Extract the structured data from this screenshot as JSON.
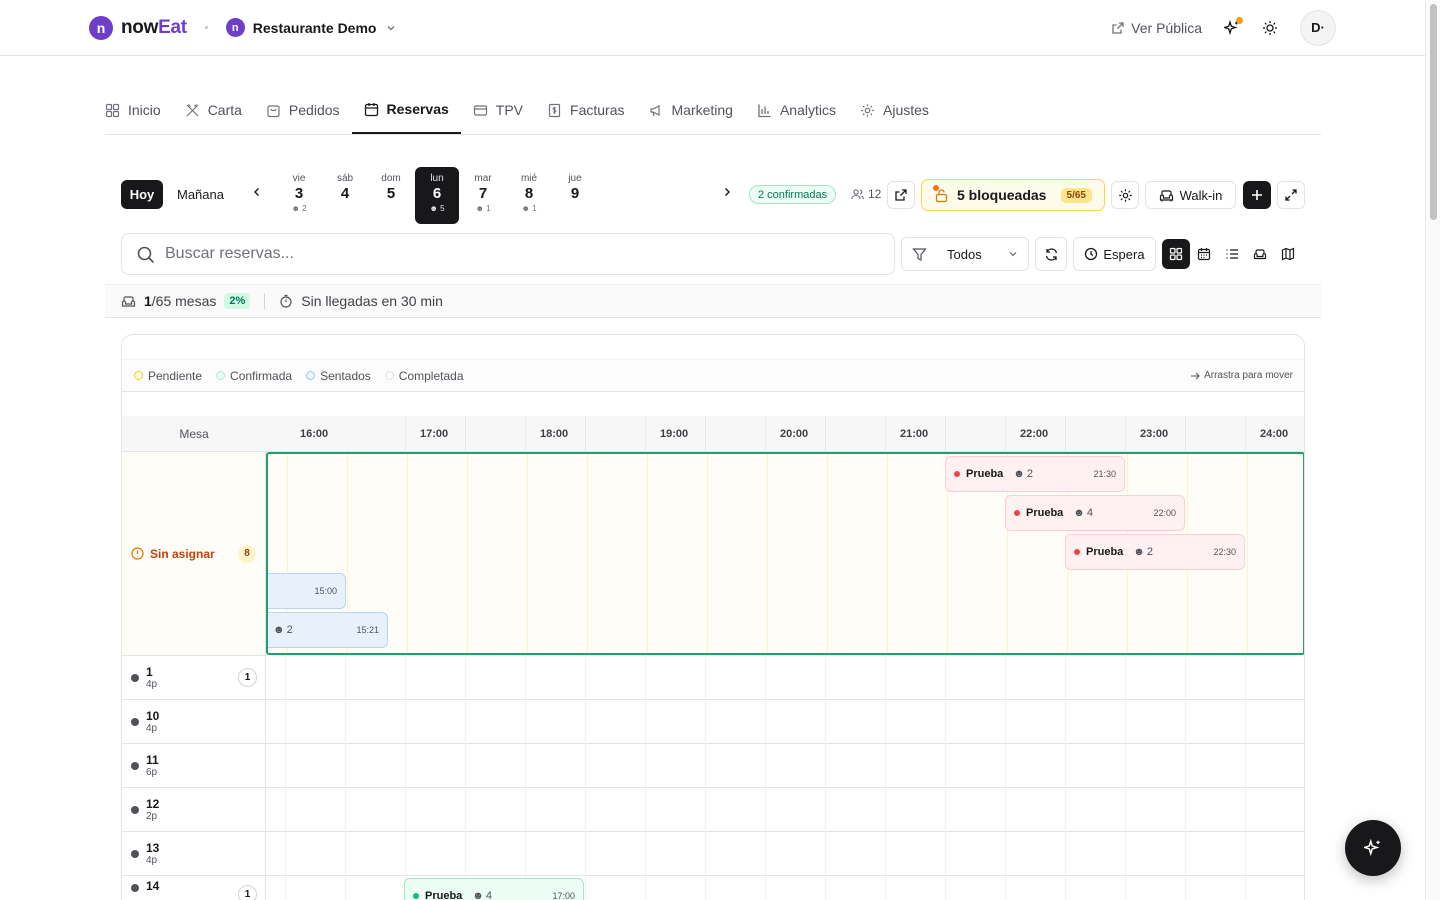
{
  "header": {
    "brand_a": "now",
    "brand_b": "Eat",
    "brand_mark": "n",
    "restaurant_mark": "n",
    "restaurant": "Restaurante Demo",
    "ver_publica": "Ver Pública",
    "avatar": "D·"
  },
  "nav": [
    {
      "label": "Inicio",
      "icon": "grid-icon"
    },
    {
      "label": "Carta",
      "icon": "utensils-icon"
    },
    {
      "label": "Pedidos",
      "icon": "bag-icon"
    },
    {
      "label": "Reservas",
      "icon": "calendar-icon",
      "active": true
    },
    {
      "label": "TPV",
      "icon": "card-icon"
    },
    {
      "label": "Facturas",
      "icon": "invoice-icon"
    },
    {
      "label": "Marketing",
      "icon": "megaphone-icon"
    },
    {
      "label": "Analytics",
      "icon": "bar-chart-icon"
    },
    {
      "label": "Ajustes",
      "icon": "gear-icon"
    }
  ],
  "daybar": {
    "hoy": "Hoy",
    "manana": "Mañana",
    "days": [
      {
        "name": "vie",
        "num": "3",
        "count": "2"
      },
      {
        "name": "sáb",
        "num": "4",
        "count": ""
      },
      {
        "name": "dom",
        "num": "5",
        "count": ""
      },
      {
        "name": "lun",
        "num": "6",
        "count": "5",
        "selected": true
      },
      {
        "name": "mar",
        "num": "7",
        "count": "1"
      },
      {
        "name": "mié",
        "num": "8",
        "count": "1"
      },
      {
        "name": "jue",
        "num": "9",
        "count": ""
      }
    ],
    "confirmadas": "2 confirmadas",
    "people": "12",
    "bloqueadas": "5 bloqueadas",
    "bloqueadas_count": "5/65",
    "walkin": "Walk-in"
  },
  "search": {
    "placeholder": "Buscar reservas..."
  },
  "filter": {
    "value": "Todos"
  },
  "espera": "Espera",
  "stats": {
    "occupied": "1",
    "total_tables": "/65 mesas",
    "pct": "2%",
    "arrivals": "Sin llegadas en 30 min"
  },
  "legend": {
    "items": [
      {
        "label": "Pendiente",
        "color": "#facc15"
      },
      {
        "label": "Confirmada",
        "color": "#6ee7b7"
      },
      {
        "label": "Sentados",
        "color": "#60a5fa"
      },
      {
        "label": "Completada",
        "color": "#d4d4d8"
      }
    ],
    "drag": "Arrastra para mover"
  },
  "timeline": {
    "mesa_header": "Mesa",
    "hours": [
      "16:00",
      "17:00",
      "18:00",
      "19:00",
      "20:00",
      "21:00",
      "22:00",
      "23:00",
      "24:00"
    ],
    "unassigned_label": "Sin asignar",
    "unassigned_count": "8",
    "unassigned_reservations": [
      {
        "name": "Prueba",
        "people": "2",
        "time": "21:30",
        "status": "pending"
      },
      {
        "name": "Prueba",
        "people": "4",
        "time": "22:00",
        "status": "pending"
      },
      {
        "name": "Prueba",
        "people": "2",
        "time": "22:30",
        "status": "pending"
      },
      {
        "name": "",
        "people": "",
        "time": "15:00",
        "status": "seated"
      },
      {
        "name": "",
        "people": "2",
        "time": "15:21",
        "status": "seated"
      }
    ],
    "tables": [
      {
        "name": "1",
        "cap": "4p",
        "count": "1"
      },
      {
        "name": "10",
        "cap": "4p",
        "count": ""
      },
      {
        "name": "11",
        "cap": "6p",
        "count": ""
      },
      {
        "name": "12",
        "cap": "2p",
        "count": ""
      },
      {
        "name": "13",
        "cap": "4p",
        "count": ""
      },
      {
        "name": "14",
        "cap": "",
        "count": "1"
      }
    ],
    "table_reservation": {
      "name": "Prueba",
      "people": "4",
      "time": "17:00",
      "status": "confirmed"
    }
  }
}
